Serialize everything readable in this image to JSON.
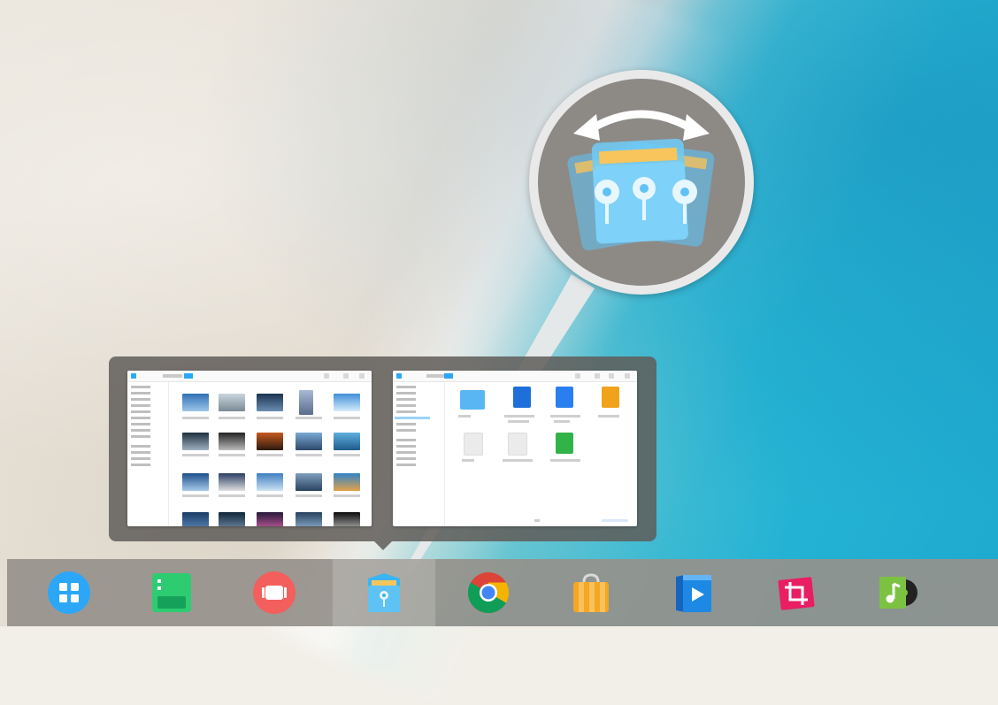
{
  "desktop": {
    "wallpaper": "beach"
  },
  "window_preview": {
    "windows": [
      {
        "name": "file-manager-pictures",
        "view": "grid-of-photos"
      },
      {
        "name": "file-manager-documents",
        "view": "grid-of-files"
      }
    ]
  },
  "magnifier": {
    "icon": "file-manager-stack-icon",
    "gesture_icon": "swap-arrows-icon"
  },
  "dock": {
    "items": [
      {
        "name": "launcher",
        "icon": "launcher-icon",
        "color": "#2ca7f8"
      },
      {
        "name": "multitasking-view",
        "icon": "multitasking-icon",
        "color": "#2ecc71"
      },
      {
        "name": "screen-recorder",
        "icon": "screen-recorder-icon",
        "color": "#f25f5c"
      },
      {
        "name": "file-manager",
        "icon": "file-manager-icon",
        "color": "#3ab4f2",
        "active": true
      },
      {
        "name": "chrome",
        "icon": "chrome-icon",
        "color": "#4285f4"
      },
      {
        "name": "app-store",
        "icon": "app-store-icon",
        "color": "#f5a623"
      },
      {
        "name": "movie-player",
        "icon": "movie-player-icon",
        "color": "#1e88e5"
      },
      {
        "name": "screenshot-tool",
        "icon": "screenshot-crop-icon",
        "color": "#e91e63"
      },
      {
        "name": "music-player",
        "icon": "music-player-icon",
        "color": "#7cc242"
      }
    ]
  }
}
